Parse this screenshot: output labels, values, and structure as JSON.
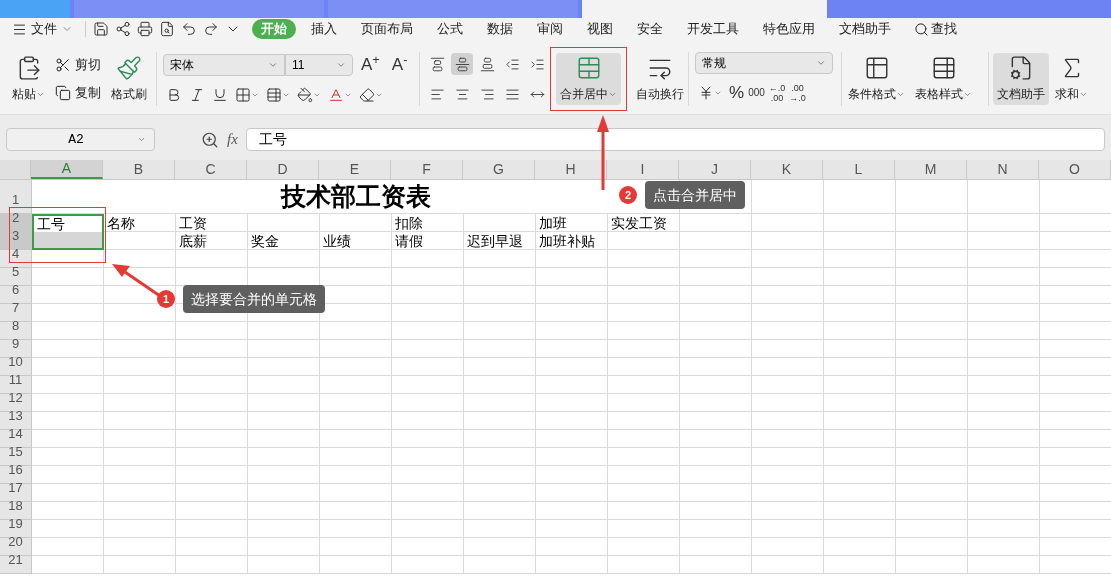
{
  "menu": {
    "file": "文件",
    "tabs": [
      {
        "label": "开始",
        "selected": true
      },
      {
        "label": "插入",
        "selected": false
      },
      {
        "label": "页面布局",
        "selected": false
      },
      {
        "label": "公式",
        "selected": false
      },
      {
        "label": "数据",
        "selected": false
      },
      {
        "label": "审阅",
        "selected": false
      },
      {
        "label": "视图",
        "selected": false
      },
      {
        "label": "安全",
        "selected": false
      },
      {
        "label": "开发工具",
        "selected": false
      },
      {
        "label": "特色应用",
        "selected": false
      },
      {
        "label": "文档助手",
        "selected": false
      }
    ],
    "search": "查找"
  },
  "ribbon": {
    "clipboard": {
      "paste": "粘贴",
      "cut": "剪切",
      "copy": "复制",
      "format_painter": "格式刷"
    },
    "font": {
      "name": "宋体",
      "size": "11",
      "grow": "A$^{+}$",
      "shrink": "A$^{-}$"
    },
    "align_buttons": [
      {
        "kind": "top",
        "selected": false
      },
      {
        "kind": "middle",
        "selected": true
      },
      {
        "kind": "bottom",
        "selected": false
      },
      {
        "kind": "outdent",
        "selected": false
      },
      {
        "kind": "indent",
        "selected": false
      },
      {
        "kind": "left",
        "selected": false
      },
      {
        "kind": "center",
        "selected": false
      },
      {
        "kind": "right",
        "selected": false
      },
      {
        "kind": "justify",
        "selected": false
      },
      {
        "kind": "distribute",
        "selected": false
      }
    ],
    "merge": {
      "label": "合并居中",
      "selected": true
    },
    "wrap": "自动换行",
    "number": {
      "format": "常规",
      "percent": "%",
      "thousands": "000",
      "increase_decimal": [
        "←.0",
        ".00"
      ],
      "decrease_decimal": [
        ".00",
        "→.0"
      ]
    },
    "conditional": "条件格式",
    "table_style": "表格样式",
    "assistant": {
      "label": "文档助手",
      "selected": true
    },
    "sum": "求和"
  },
  "formula_bar": {
    "cell_ref": "A2",
    "fx": "fx",
    "value": "工号"
  },
  "sheet": {
    "title": "技术部工资表",
    "columns": [
      {
        "label": "A",
        "selected": true
      },
      {
        "label": "B",
        "selected": false
      },
      {
        "label": "C",
        "selected": false
      },
      {
        "label": "D",
        "selected": false
      },
      {
        "label": "E",
        "selected": false
      },
      {
        "label": "F",
        "selected": false
      },
      {
        "label": "G",
        "selected": false
      },
      {
        "label": "H",
        "selected": false
      },
      {
        "label": "I",
        "selected": false
      },
      {
        "label": "J",
        "selected": false
      },
      {
        "label": "K",
        "selected": false
      },
      {
        "label": "L",
        "selected": false
      },
      {
        "label": "M",
        "selected": false
      },
      {
        "label": "N",
        "selected": false
      },
      {
        "label": "O",
        "selected": false
      }
    ],
    "rows": [
      {
        "number": "1",
        "selected": false
      },
      {
        "number": "2",
        "selected": true,
        "cells": [
          "工号",
          "名称",
          "工资",
          null,
          null,
          "扣除",
          null,
          "加班",
          "实发工资"
        ]
      },
      {
        "number": "3",
        "selected": true,
        "cells": [
          null,
          null,
          "底薪",
          "奖金",
          "业绩",
          "请假",
          "迟到早退",
          "加班补贴"
        ]
      },
      {
        "number": "4",
        "selected": false
      },
      {
        "number": "5",
        "selected": false
      },
      {
        "number": "6",
        "selected": false
      },
      {
        "number": "7",
        "selected": false
      },
      {
        "number": "8",
        "selected": false
      },
      {
        "number": "9",
        "selected": false
      },
      {
        "number": "10",
        "selected": false
      },
      {
        "number": "11",
        "selected": false
      },
      {
        "number": "12",
        "selected": false
      },
      {
        "number": "13",
        "selected": false
      },
      {
        "number": "14",
        "selected": false
      },
      {
        "number": "15",
        "selected": false
      },
      {
        "number": "16",
        "selected": false
      },
      {
        "number": "17",
        "selected": false
      },
      {
        "number": "18",
        "selected": false
      },
      {
        "number": "19",
        "selected": false
      },
      {
        "number": "20",
        "selected": false
      },
      {
        "number": "21",
        "selected": false
      }
    ]
  },
  "callouts": [
    {
      "number": "1",
      "text": "选择要合并的单元格"
    },
    {
      "number": "2",
      "text": "点击合并居中"
    }
  ]
}
